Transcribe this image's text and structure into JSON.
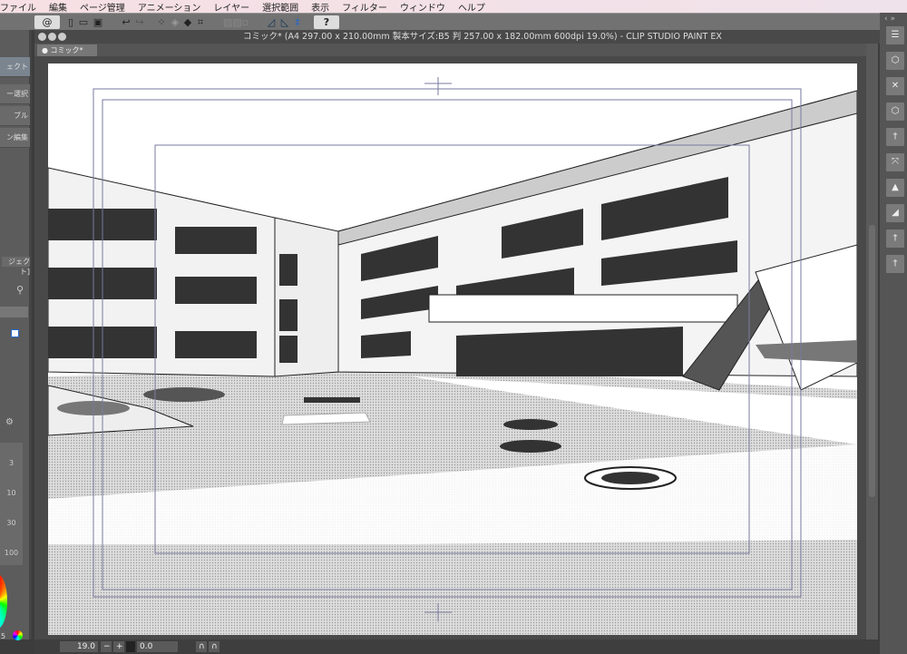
{
  "menu": [
    "ファイル",
    "編集",
    "ページ管理",
    "アニメーション",
    "レイヤー",
    "選択範囲",
    "表示",
    "フィルター",
    "ウィンドウ",
    "ヘルプ"
  ],
  "window": {
    "title": "コミック* (A4 297.00 x 210.00mm 製本サイズ:B5 判 257.00 x 182.00mm 600dpi 19.0%)  - CLIP STUDIO PAINT EX",
    "tab": "● コミック*"
  },
  "toolbar": {
    "icons": [
      "clip-studio-logo-icon",
      "new-icon",
      "open-icon",
      "save-icon",
      "undo-icon",
      "redo-icon",
      "clear-selection-icon",
      "fill-icon",
      "transform-icon",
      "ruler-snap-icon",
      "perspective-snap-icon",
      "help-icon"
    ],
    "help": "?"
  },
  "left_panel": {
    "items": [
      "ェクト",
      "ー選択",
      "ブル",
      "ン編集"
    ],
    "layer_label": "ジェクト]",
    "brush_sizes": [
      "3",
      "10",
      "30",
      "100"
    ],
    "color_value": "5"
  },
  "status": {
    "zoom": "19.0",
    "angle": "0.0"
  },
  "right_panel": {
    "icons": [
      "layer-property-icon",
      "3d-object-icon",
      "3d-camera-icon",
      "3d-box-icon",
      "3d-figure-icon",
      "3d-move-icon",
      "image-material-icon",
      "edit-material-icon",
      "figure-pose-icon",
      "figure-pose-2-icon"
    ]
  }
}
